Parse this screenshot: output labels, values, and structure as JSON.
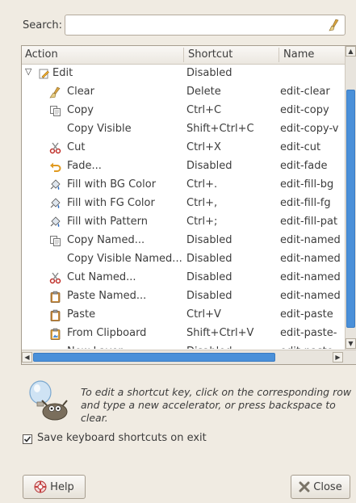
{
  "search": {
    "label": "Search:",
    "value": "",
    "placeholder": ""
  },
  "tree": {
    "columns": [
      "Action",
      "Shortcut",
      "Name"
    ],
    "rows": [
      {
        "action": "Edit",
        "shortcut": "Disabled",
        "name": "",
        "icon": "edit-icon",
        "level": 0,
        "expanded": true
      },
      {
        "action": "Clear",
        "shortcut": "Delete",
        "name": "edit-clear",
        "icon": "brush-icon",
        "level": 1
      },
      {
        "action": "Copy",
        "shortcut": "Ctrl+C",
        "name": "edit-copy",
        "icon": "copy-icon",
        "level": 1
      },
      {
        "action": "Copy Visible",
        "shortcut": "Shift+Ctrl+C",
        "name": "edit-copy-v",
        "icon": "",
        "level": 1
      },
      {
        "action": "Cut",
        "shortcut": "Ctrl+X",
        "name": "edit-cut",
        "icon": "scissors-icon",
        "level": 1
      },
      {
        "action": "Fade...",
        "shortcut": "Disabled",
        "name": "edit-fade",
        "icon": "undo-icon",
        "level": 1
      },
      {
        "action": "Fill with BG Color",
        "shortcut": "Ctrl+.",
        "name": "edit-fill-bg",
        "icon": "bucket-icon",
        "level": 1
      },
      {
        "action": "Fill with FG Color",
        "shortcut": "Ctrl+,",
        "name": "edit-fill-fg",
        "icon": "bucket-icon",
        "level": 1
      },
      {
        "action": "Fill with Pattern",
        "shortcut": "Ctrl+;",
        "name": "edit-fill-pat",
        "icon": "bucket-icon",
        "level": 1
      },
      {
        "action": "Copy Named...",
        "shortcut": "Disabled",
        "name": "edit-named",
        "icon": "copy-icon",
        "level": 1
      },
      {
        "action": "Copy Visible Named...",
        "shortcut": "Disabled",
        "name": "edit-named",
        "icon": "",
        "level": 1
      },
      {
        "action": "Cut Named...",
        "shortcut": "Disabled",
        "name": "edit-named",
        "icon": "scissors-icon",
        "level": 1
      },
      {
        "action": "Paste Named...",
        "shortcut": "Disabled",
        "name": "edit-named",
        "icon": "clipboard-icon",
        "level": 1
      },
      {
        "action": "Paste",
        "shortcut": "Ctrl+V",
        "name": "edit-paste",
        "icon": "clipboard-icon",
        "level": 1
      },
      {
        "action": "From Clipboard",
        "shortcut": "Shift+Ctrl+V",
        "name": "edit-paste-",
        "icon": "image-clipboard-icon",
        "level": 1
      },
      {
        "action": "New Layer",
        "shortcut": "Disabled",
        "name": "edit-paste-",
        "icon": "",
        "level": 1
      }
    ]
  },
  "info": {
    "line1": "To edit a shortcut key, click on the corresponding row",
    "line2": "and type a new accelerator, or press backspace to clear."
  },
  "save_option": {
    "label": "Save keyboard shortcuts on exit",
    "checked": true
  },
  "buttons": {
    "help": "Help",
    "close": "Close"
  },
  "colors": {
    "background": "#f0ebe2",
    "accent": "#4a90d9"
  }
}
